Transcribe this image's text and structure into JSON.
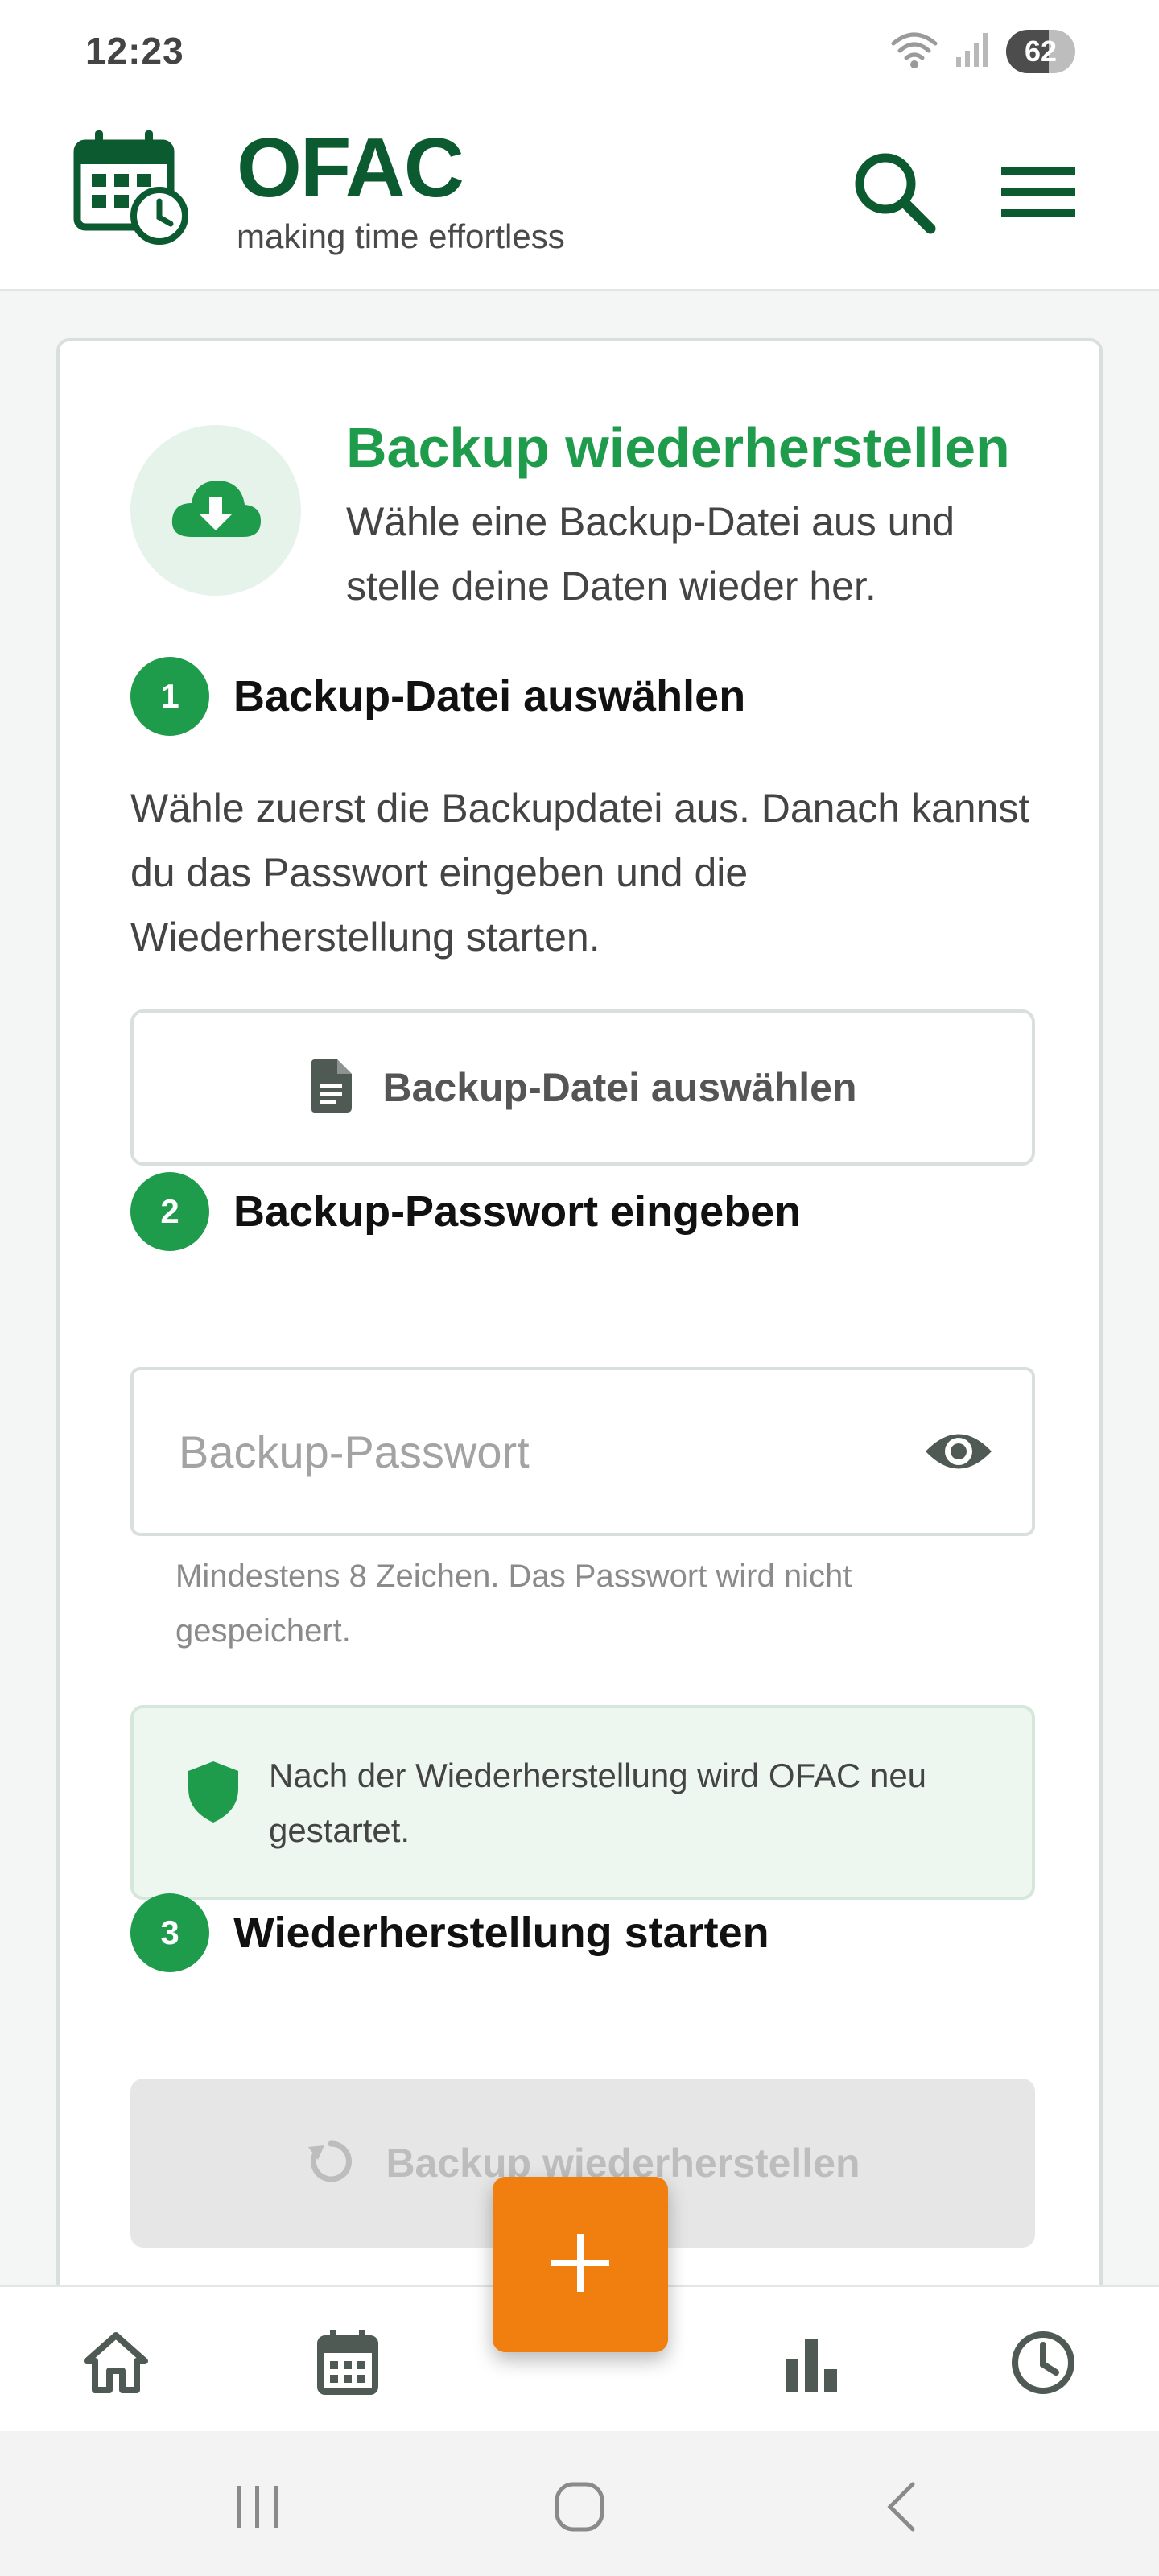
{
  "status_bar": {
    "time": "12:23",
    "battery_percent": "62",
    "battery_level": 0.62,
    "icons": [
      "wifi-icon",
      "signal-icon"
    ]
  },
  "header": {
    "app_name": "OFAC",
    "tagline": "making time effortless",
    "icons": [
      "calendar-clock-logo-icon",
      "search-icon",
      "hamburger-menu-icon"
    ]
  },
  "card": {
    "title": "Backup wiederherstellen",
    "description": "Wähle eine Backup-Datei aus und stelle deine Daten wieder her.",
    "hero_icon": "cloud-download-icon",
    "step1": {
      "number": "1",
      "title": "Backup-Datei auswählen",
      "description": "Wähle zuerst die Backupdatei aus. Danach kannst du das Passwort eingeben und die Wiederherstellung starten.",
      "button_label": "Backup-Datei auswählen",
      "button_icon": "file-icon"
    },
    "step2": {
      "number": "2",
      "title": "Backup-Passwort eingeben",
      "password_placeholder": "Backup-Passwort",
      "password_value": "",
      "visibility_icon": "eye-icon",
      "hint": "Mindestens 8 Zeichen. Das Passwort wird nicht gespeichert."
    },
    "info": {
      "icon": "shield-icon",
      "text": "Nach der Wiederherstellung wird OFAC neu gestartet."
    },
    "step3": {
      "number": "3",
      "title": "Wiederherstellung starten",
      "button_label": "Backup wiederherstellen",
      "button_icon": "refresh-icon",
      "button_disabled": true
    }
  },
  "bottom_nav": {
    "items": [
      "home-icon",
      "calendar-icon",
      "add-icon",
      "bar-chart-icon",
      "clock-icon"
    ]
  },
  "colors": {
    "brand_dark_green": "#0c5a2f",
    "accent_green": "#1e9b4b",
    "fab_orange": "#f07f10"
  }
}
